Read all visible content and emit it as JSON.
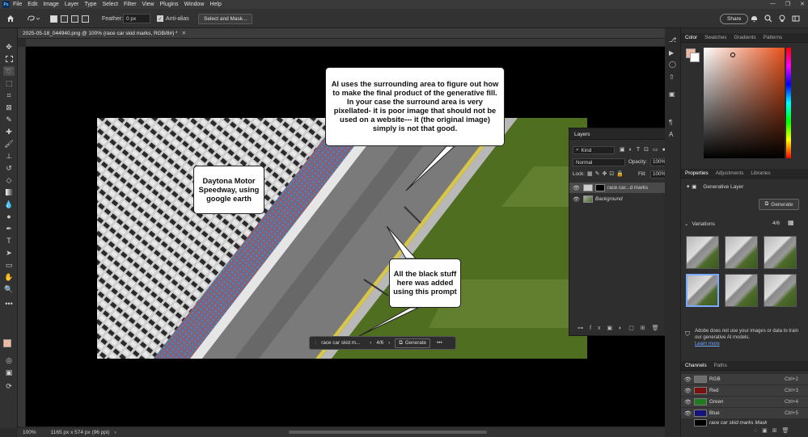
{
  "menubar": {
    "items": [
      "File",
      "Edit",
      "Image",
      "Layer",
      "Type",
      "Select",
      "Filter",
      "View",
      "Plugins",
      "Window",
      "Help"
    ]
  },
  "options": {
    "feather_label": "Feather:",
    "feather_value": "0 px",
    "antialias_label": "Anti-alias",
    "select_mask_label": "Select and Mask...",
    "share_label": "Share"
  },
  "document": {
    "tab_title": "2025-05-18_044940.png @ 100% (race car skid marks, RGB/8#) *",
    "zoom": "100%",
    "dimensions": "1165 px x 574 px (96 ppi)"
  },
  "callouts": {
    "top": "AI uses the surrounding area to figure out how to make the final product of the generative fill.   In your case the surround area is very pixellated- it is poor image that should not be used on a website--- it (the original image) simply is not that good.",
    "left": "Daytona Motor Speedway, using google earth",
    "bottom": "All the black stuff here was added using this prompt"
  },
  "taskbar": {
    "prompt": "race car skid m...",
    "counter": "4/6",
    "generate_label": "Generate",
    "more": "•••"
  },
  "layers_panel": {
    "tab": "Layers",
    "filter_kind": "Kind",
    "blend_mode": "Normal",
    "opacity_label": "Opacity:",
    "opacity_value": "100%",
    "lock_label": "Lock:",
    "fill_label": "Fill:",
    "fill_value": "100%",
    "layers": [
      {
        "name": "race car...d marks"
      },
      {
        "name": "Background"
      }
    ]
  },
  "color_panel": {
    "tabs": [
      "Color",
      "Swatches",
      "Gradients",
      "Patterns"
    ],
    "foreground": "#f2b79f",
    "background": "#ffffff"
  },
  "properties_panel": {
    "tabs": [
      "Properties",
      "Adjustments",
      "Libraries"
    ],
    "layer_type": "Generative Layer",
    "generate_label": "Generate",
    "variations_label": "Variations",
    "variations_count": "4/6",
    "notice": "Adobe does not use your images or data to train our generative AI models.",
    "learn_more": "Learn more"
  },
  "channels_panel": {
    "tabs": [
      "Channels",
      "Paths"
    ],
    "channels": [
      {
        "name": "RGB",
        "shortcut": "Ctrl+2",
        "color": "#6d6d6d"
      },
      {
        "name": "Red",
        "shortcut": "Ctrl+3",
        "color": "#7a1010"
      },
      {
        "name": "Green",
        "shortcut": "Ctrl+4",
        "color": "#1f7a1f"
      },
      {
        "name": "Blue",
        "shortcut": "Ctrl+5",
        "color": "#13137a"
      }
    ],
    "mask_channel": "race car skid marks Mask"
  }
}
